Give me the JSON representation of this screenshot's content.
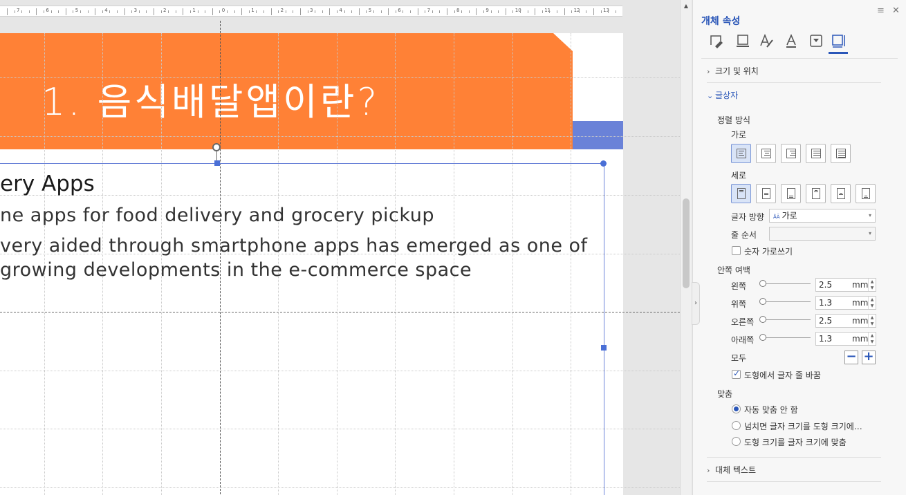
{
  "ruler": {
    "labels": [
      "7",
      "6",
      "5",
      "4",
      "3",
      "2",
      "1",
      "0",
      "1",
      "2",
      "3",
      "4",
      "5",
      "6",
      "7",
      "8",
      "9",
      "10",
      "11",
      "12",
      "13"
    ]
  },
  "slide": {
    "title": "1. 음식배달앱이란?",
    "title_band_color": "#ff8136",
    "accent_band_color": "#6a82d8",
    "textbox": {
      "heading": "ery Apps",
      "line1": "ne apps for food delivery and grocery pickup",
      "line2": "very aided through smartphone apps has emerged as one of",
      "line3": "growing developments in the e-commerce space"
    }
  },
  "panel": {
    "title": "개체 속성",
    "menu_icon": "hamburger-icon",
    "close_icon": "close-icon",
    "tabs": [
      {
        "icon": "fill-icon",
        "active": false
      },
      {
        "icon": "line-icon",
        "active": false
      },
      {
        "icon": "text-style-icon",
        "active": false
      },
      {
        "icon": "text-outline-icon",
        "active": false
      },
      {
        "icon": "effect-icon",
        "active": false
      },
      {
        "icon": "textbox-icon",
        "active": true
      }
    ],
    "sections": {
      "size_position": "크기 및 위치",
      "textbox": "글상자",
      "alt_text": "대체 텍스트"
    },
    "alignment": {
      "label": "정렬 방식",
      "horizontal_label": "가로",
      "vertical_label": "세로"
    },
    "text_direction": {
      "label": "글자 방향",
      "value": "가로"
    },
    "line_order": {
      "label": "줄 순서",
      "value": ""
    },
    "number_horizontal": "숫자 가로쓰기",
    "inner_margin": {
      "label": "안쪽 여백",
      "left": {
        "label": "왼쪽",
        "value": "2.5",
        "unit": "mm"
      },
      "top": {
        "label": "위쪽",
        "value": "1.3",
        "unit": "mm"
      },
      "right": {
        "label": "오른쪽",
        "value": "2.5",
        "unit": "mm"
      },
      "bottom": {
        "label": "아래쪽",
        "value": "1.3",
        "unit": "mm"
      },
      "all_label": "모두"
    },
    "wrap_text": "도형에서 글자 줄 바꿈",
    "fit": {
      "label": "맞춤",
      "options": [
        {
          "label": "자동 맞춤 안 함",
          "checked": true
        },
        {
          "label": "넘치면 글자 크기를 도형 크기에…",
          "checked": false
        },
        {
          "label": "도형 크기를 글자 크기에 맞춤",
          "checked": false
        }
      ]
    }
  }
}
